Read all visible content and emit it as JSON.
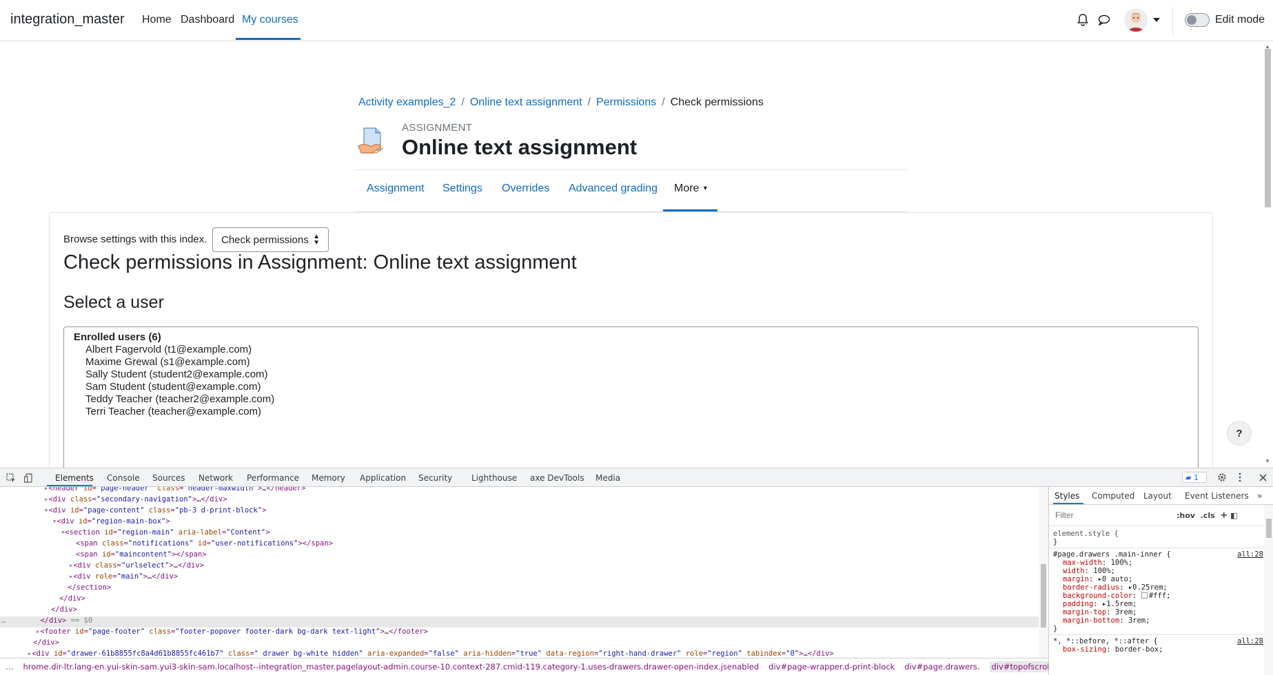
{
  "navbar": {
    "brand": "integration_master",
    "links": [
      "Home",
      "Dashboard",
      "My courses"
    ],
    "edit_mode": "Edit mode"
  },
  "breadcrumb": [
    "Activity examples_2",
    "Online text assignment",
    "Permissions",
    "Check permissions"
  ],
  "header": {
    "pretitle": "ASSIGNMENT",
    "title": "Online text assignment"
  },
  "tabs": [
    "Assignment",
    "Settings",
    "Overrides",
    "Advanced grading",
    "More"
  ],
  "content": {
    "browse_label": "Browse settings with this index.",
    "select_value": "Check permissions",
    "heading": "Check permissions in Assignment: Online text assignment",
    "subheading": "Select a user",
    "optgroup": "Enrolled users (6)",
    "users": [
      "Albert Fagervold (t1@example.com)",
      "Maxime Grewal (s1@example.com)",
      "Sally Student (student2@example.com)",
      "Sam Student (student@example.com)",
      "Teddy Teacher (teacher2@example.com)",
      "Terri Teacher (teacher@example.com)"
    ],
    "help": "?"
  },
  "devtools": {
    "tabs": [
      "Elements",
      "Console",
      "Sources",
      "Network",
      "Performance",
      "Memory",
      "Application",
      "Security",
      "Lighthouse",
      "axe DevTools",
      "Media"
    ],
    "badge": "1",
    "breadcrumbs": [
      "hrome.dir-ltr.lang-en.yui-skin-sam.yui3-skin-sam.localhost--integration_master.pagelayout-admin.course-10.context-287.cmid-119.category-1.uses-drawers.drawer-open-index.jsenabled",
      "div#page-wrapper.d-print-block",
      "div#page.drawers.",
      "div#topofscroll.main-inner"
    ],
    "styles_tabs": [
      "Styles",
      "Computed",
      "Layout",
      "Event Listeners"
    ],
    "filter_placeholder": "Filter",
    "hov": ":hov",
    "cls": ".cls",
    "element_style": "element.style {",
    "rule_selector": "#page.drawers .main-inner {",
    "rule_source": "all:28",
    "rule_props": [
      [
        "max-width",
        "100%;"
      ],
      [
        "width",
        "100%;"
      ],
      [
        "margin",
        "0 auto;"
      ],
      [
        "border-radius",
        "0.25rem;"
      ],
      [
        "background-color",
        "#fff;"
      ],
      [
        "padding",
        "1.5rem;"
      ],
      [
        "margin-top",
        "3rem;"
      ],
      [
        "margin-bottom",
        "3rem;"
      ]
    ],
    "universal_selector": "*, *::before, *::after {",
    "universal_source": "all:28",
    "universal_prop": [
      "box-sizing",
      "border-box;"
    ]
  }
}
